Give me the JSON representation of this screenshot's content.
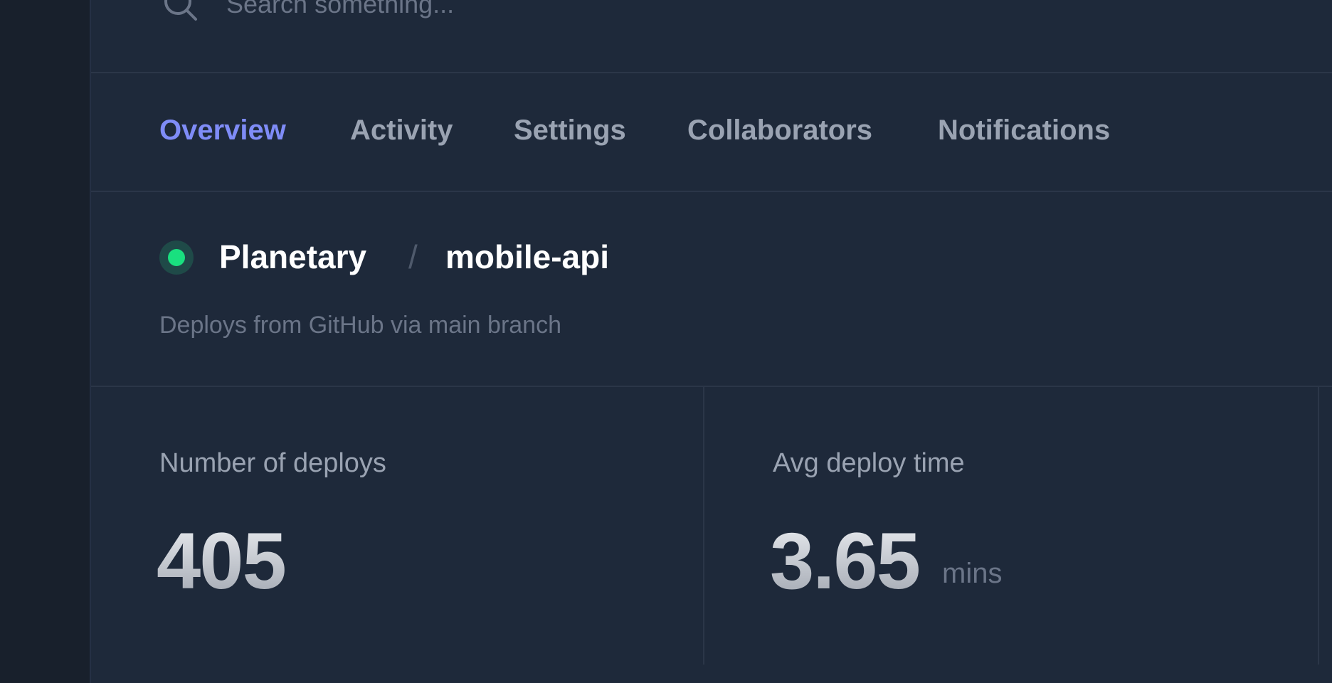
{
  "search": {
    "placeholder": "Search something..."
  },
  "icons": {
    "search": "search-icon"
  },
  "tabs": [
    {
      "label": "Overview",
      "active": true
    },
    {
      "label": "Activity",
      "active": false
    },
    {
      "label": "Settings",
      "active": false
    },
    {
      "label": "Collaborators",
      "active": false
    },
    {
      "label": "Notifications",
      "active": false
    }
  ],
  "project": {
    "organization": "Planetary",
    "separator": "/",
    "name": "mobile-api",
    "description": "Deploys from GitHub via main branch",
    "status_color": "#19e07f"
  },
  "stats": [
    {
      "label": "Number of deploys",
      "value": "405",
      "unit": ""
    },
    {
      "label": "Avg deploy time",
      "value": "3.65",
      "unit": "mins"
    }
  ],
  "colors": {
    "accent": "#7f8cf7",
    "background": "#1e293a",
    "status_ok": "#19e07f"
  }
}
